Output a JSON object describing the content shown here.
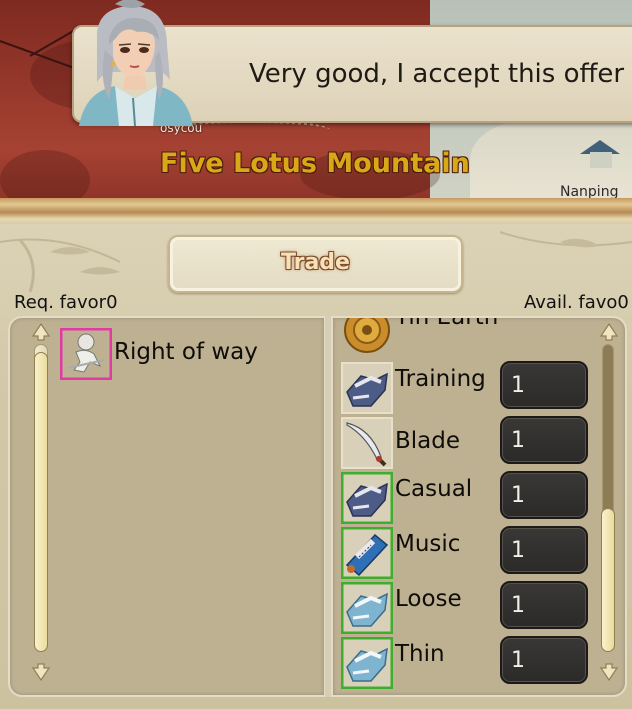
{
  "dialogue": {
    "text": "Very good, I accept this offer"
  },
  "map": {
    "location_label": "Five Lotus Mountain",
    "vertical_label": "osycou",
    "corner_label": "Nanping"
  },
  "trade": {
    "title": "Trade",
    "req_favor_label": "Req. favor",
    "req_favor_value": "0",
    "avail_favor_label": "Avail. favo",
    "avail_favor_value": "0",
    "offered_items": [
      {
        "label": "Right of way",
        "icon": "skill-figure-icon"
      }
    ],
    "inventory_items": [
      {
        "label": "Tin Earth",
        "icon": "coin-icon",
        "quantity": ""
      },
      {
        "label": "Training",
        "icon": "clothing-icon",
        "quantity": "1"
      },
      {
        "label": "Blade",
        "icon": "saber-icon",
        "quantity": "1"
      },
      {
        "label": "Casual",
        "icon": "clothing-icon",
        "quantity": "1"
      },
      {
        "label": "Music",
        "icon": "scroll-icon",
        "quantity": "1"
      },
      {
        "label": "Loose",
        "icon": "clothing-light-icon",
        "quantity": "1"
      },
      {
        "label": "Thin",
        "icon": "clothing-light-icon",
        "quantity": "1"
      }
    ]
  },
  "colors": {
    "accent_title": "#f7e2b8",
    "quality_green": "#3fae2e",
    "quality_pink": "#e23aa5",
    "qty_box": "#2b2a28"
  }
}
